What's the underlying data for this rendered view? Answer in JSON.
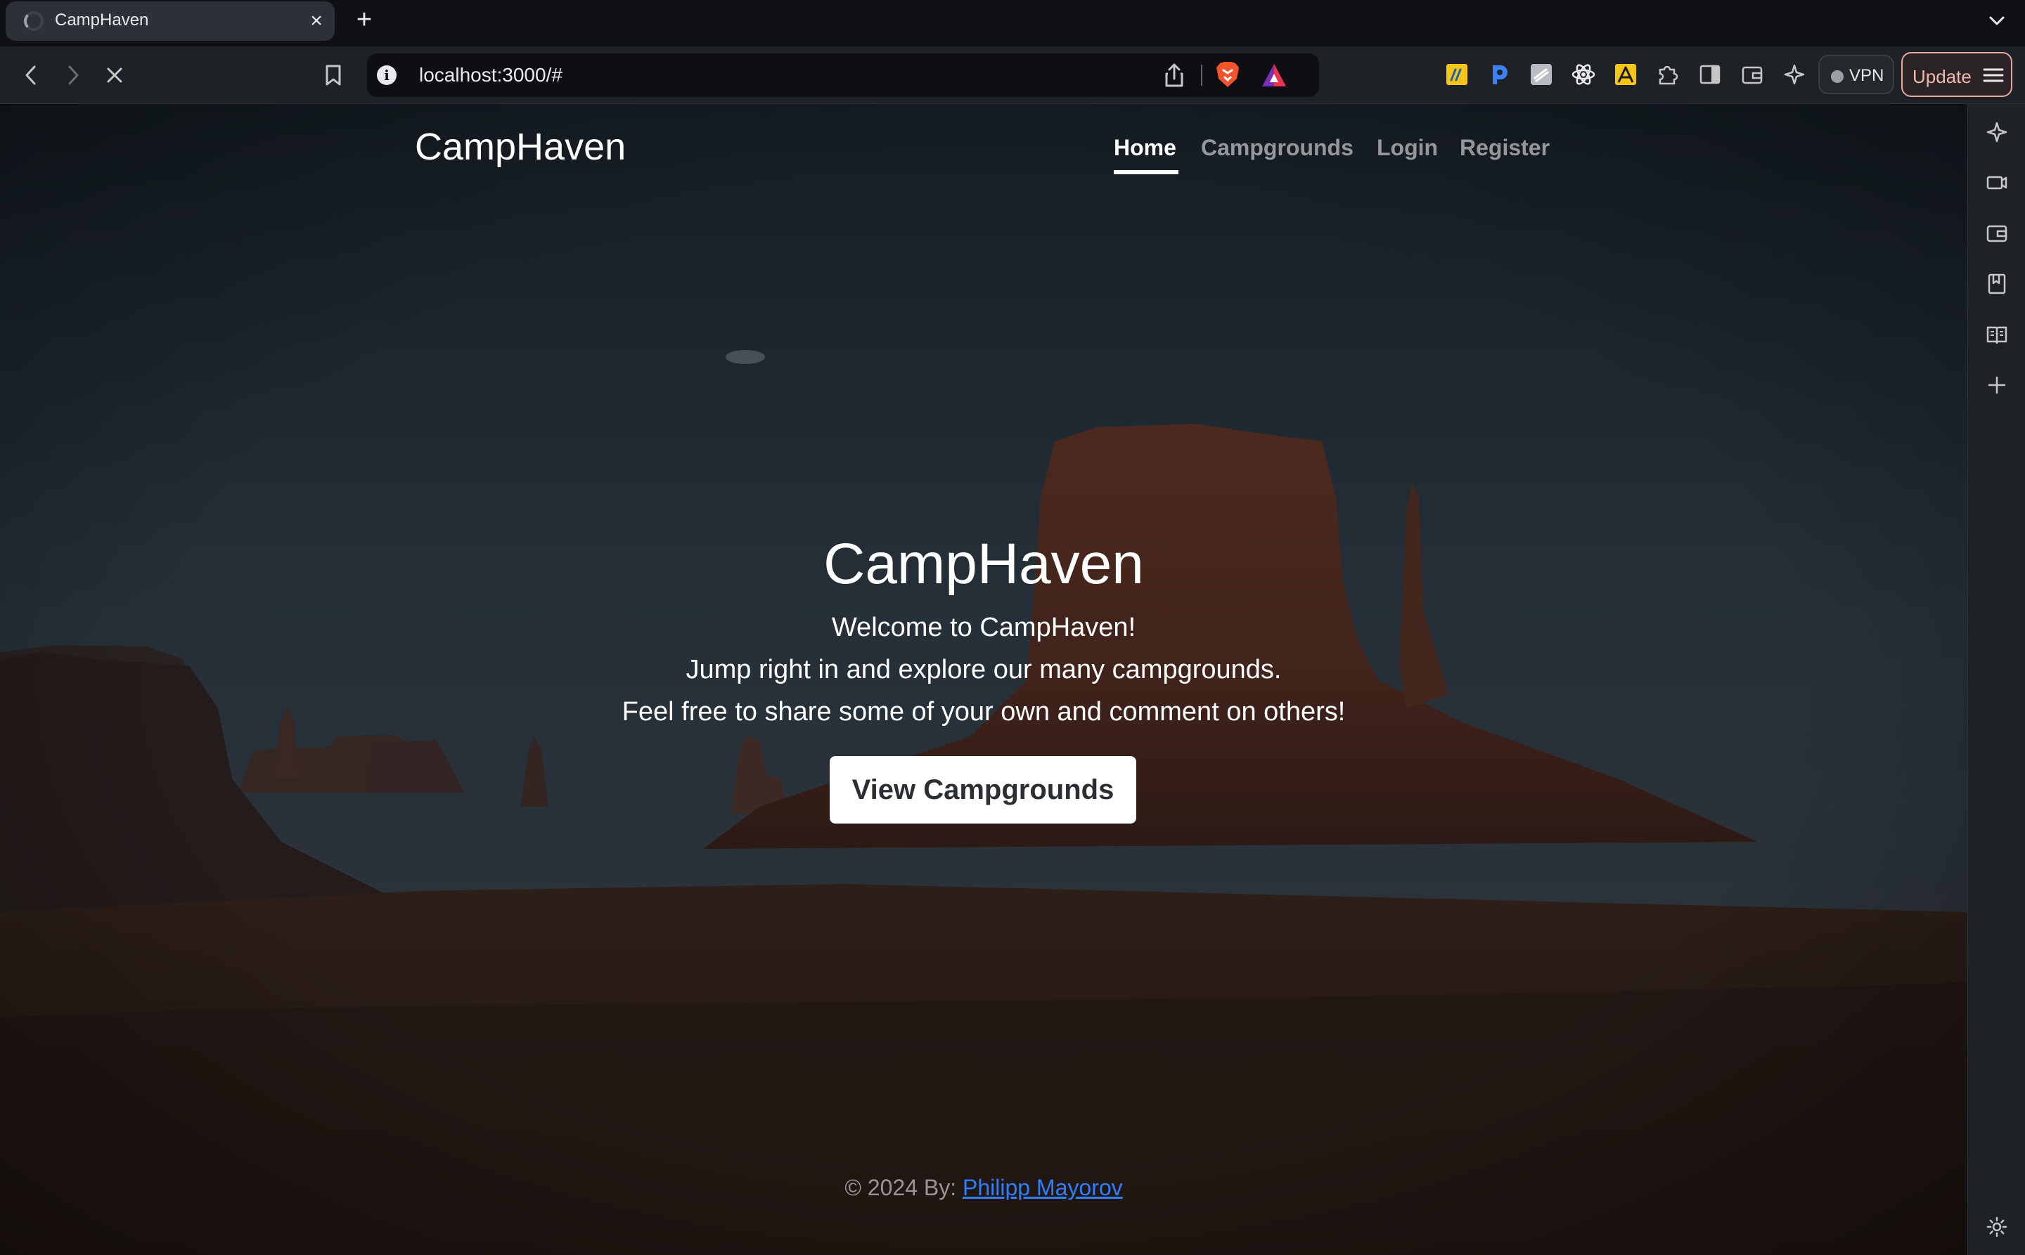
{
  "browser": {
    "tab": {
      "title": "CampHaven",
      "close_glyph": "×",
      "loading": true
    },
    "new_tab_glyph": "+",
    "address": {
      "url": "localhost:3000/#",
      "info_glyph": "i"
    },
    "vpn_label": "VPN",
    "update_label": "Update",
    "extensions": [
      "note-extension-icon",
      "p-extension-icon",
      "stack-extension-icon",
      "react-devtools-icon",
      "tampermonkey-icon",
      "puzzle-extensions-icon",
      "sidebar-toggle-icon",
      "wallet-icon",
      "leo-ai-icon"
    ],
    "sidebar_items": [
      "leo-ai-icon",
      "talk-icon",
      "wallet-icon",
      "bookmarks-icon",
      "reading-list-icon",
      "add-panel-icon",
      "settings-icon"
    ]
  },
  "site": {
    "brand": "CampHaven",
    "nav": [
      {
        "label": "Home",
        "active": true
      },
      {
        "label": "Campgrounds",
        "active": false
      },
      {
        "label": "Login",
        "active": false
      },
      {
        "label": "Register",
        "active": false
      }
    ],
    "hero": {
      "title": "CampHaven",
      "lines": [
        "Welcome to CampHaven!",
        "Jump right in and explore our many campgrounds.",
        "Feel free to share some of your own and comment on others!"
      ],
      "button_label": "View Campgrounds"
    },
    "footer": {
      "prefix": "© 2024 By: ",
      "author": "Philipp Mayorov"
    }
  },
  "colors": {
    "link": "#2d7fff",
    "chrome_bg": "#1e2125",
    "tabstrip_bg": "#0f1114",
    "update_accent": "#f2b8ad"
  }
}
